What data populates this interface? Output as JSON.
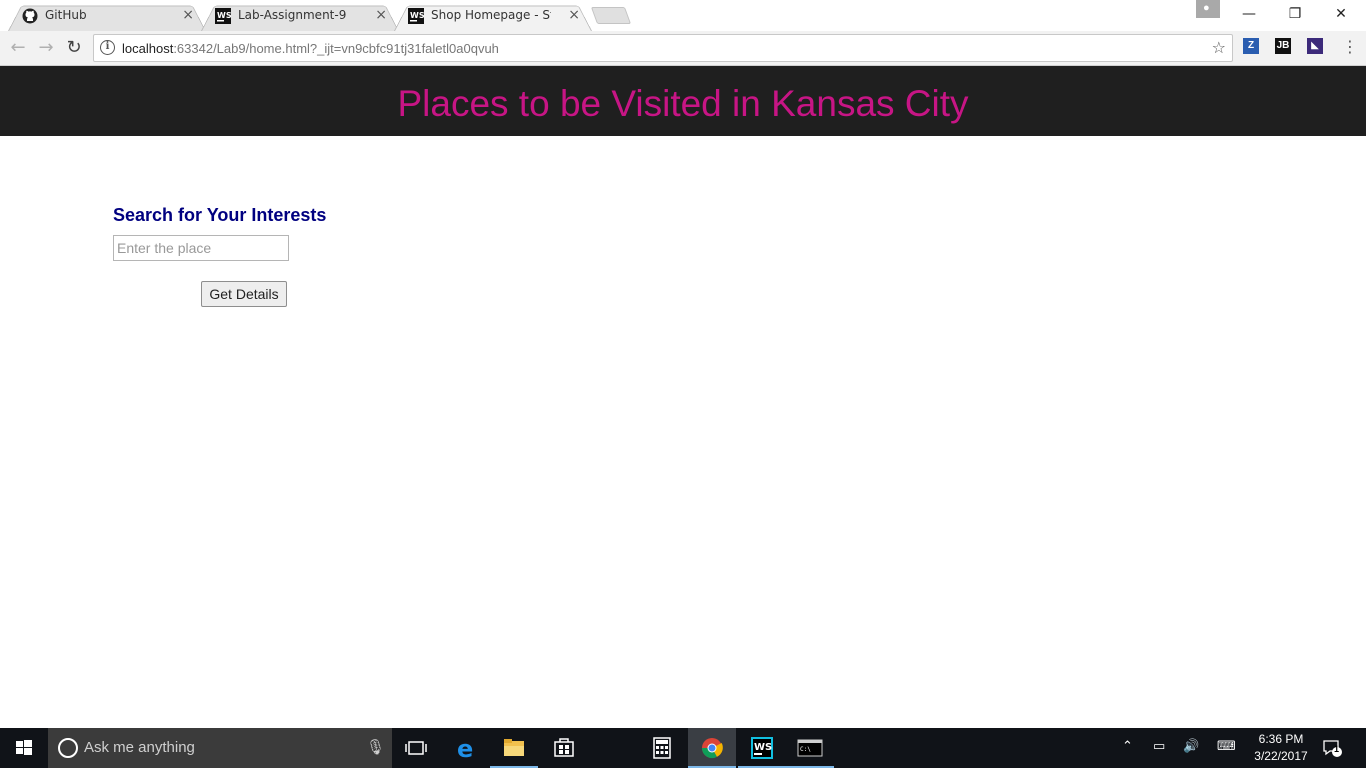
{
  "browser": {
    "tabs": [
      {
        "title": "GitHub",
        "active": false,
        "icon": "github-icon"
      },
      {
        "title": "Lab-Assignment-9",
        "active": false,
        "icon": "webstorm-icon"
      },
      {
        "title": "Shop Homepage - Start B",
        "active": true,
        "icon": "webstorm-icon"
      }
    ],
    "tab_close": "×",
    "url_host": "localhost",
    "url_rest": ":63342/Lab9/home.html?_ijt=vn9cbfc91tj31faletl0a0qvuh",
    "window_controls": {
      "minimize": "—",
      "maximize": "❐",
      "close": "✕"
    }
  },
  "page": {
    "title": "Places to be Visited in Kansas City",
    "search_heading": "Search for Your Interests",
    "search_placeholder": "Enter the place",
    "search_value": "",
    "button_label": "Get Details"
  },
  "taskbar": {
    "search_text": "Ask me anything",
    "time": "6:36 PM",
    "date": "3/22/2017",
    "notification_count": "1"
  },
  "colors": {
    "header_bg": "#1f1f1f",
    "title": "#c71585",
    "heading": "#000080"
  }
}
